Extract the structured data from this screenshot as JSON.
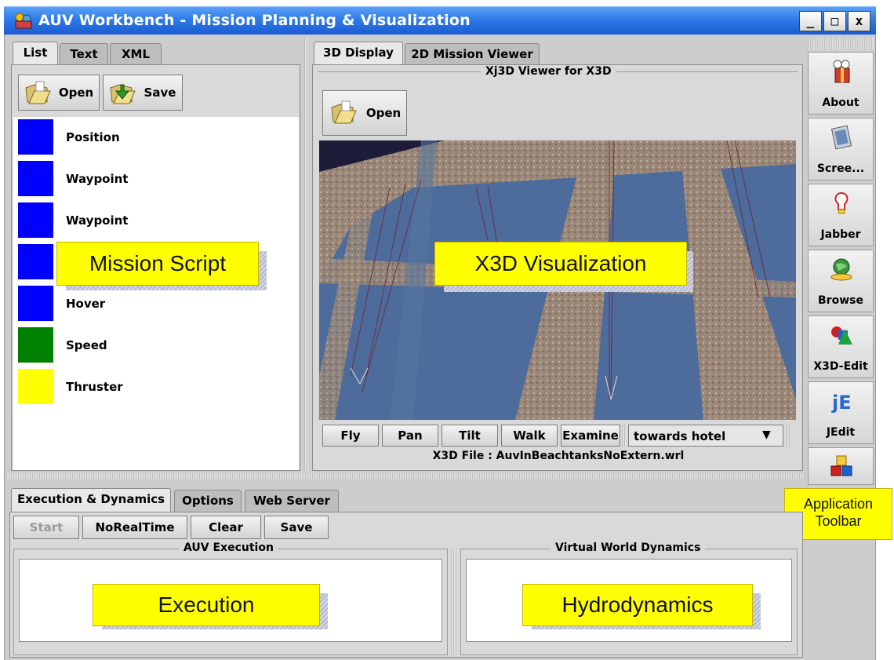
{
  "window": {
    "title": "AUV Workbench - Mission Planning & Visualization",
    "minimize": "_",
    "maximize": "□",
    "close": "x"
  },
  "left_tabs": [
    "List",
    "Text",
    "XML"
  ],
  "left_toolbar": {
    "open": "Open",
    "save": "Save"
  },
  "mission_items": [
    {
      "label": "Position",
      "color": "#0000ff"
    },
    {
      "label": "Waypoint",
      "color": "#0000ff"
    },
    {
      "label": "Waypoint",
      "color": "#0000ff"
    },
    {
      "label": "",
      "color": "#0000ff"
    },
    {
      "label": "Hover",
      "color": "#0000ff"
    },
    {
      "label": "Speed",
      "color": "#008000"
    },
    {
      "label": "Thruster",
      "color": "#ffff00"
    }
  ],
  "callouts": {
    "mission_script": "Mission Script",
    "x3d_visualization": "X3D Visualization",
    "application_toolbar_line1": "Application",
    "application_toolbar_line2": "Toolbar",
    "execution": "Execution",
    "hydrodynamics": "Hydrodynamics"
  },
  "center_tabs": [
    "3D Display",
    "2D Mission Viewer"
  ],
  "viewer": {
    "group_title": "Xj3D Viewer for X3D",
    "open": "Open",
    "nav_buttons": [
      "Fly",
      "Pan",
      "Tilt",
      "Walk",
      "Examine"
    ],
    "viewpoint": "towards hotel",
    "file_label": "X3D File : AuvInBeachtanksNoExtern.wrl"
  },
  "right_toolbar": [
    {
      "label": "About",
      "icon": "about-icon"
    },
    {
      "label": "Scree...",
      "icon": "screen-icon"
    },
    {
      "label": "Jabber",
      "icon": "jabber-icon"
    },
    {
      "label": "Browse",
      "icon": "browse-icon"
    },
    {
      "label": "X3D-Edit",
      "icon": "x3d-edit-icon"
    },
    {
      "label": "JEdit",
      "icon": "jedit-icon"
    },
    {
      "label": "",
      "icon": "cubes-icon"
    }
  ],
  "bottom_tabs": [
    "Execution & Dynamics",
    "Options",
    "Web Server"
  ],
  "bottom_buttons": {
    "start": "Start",
    "norealtime": "NoRealTime",
    "clear": "Clear",
    "save": "Save"
  },
  "bottom_groups": {
    "auv_execution": "AUV Execution",
    "virtual_world": "Virtual World Dynamics"
  },
  "colors": {
    "title_bar": "#2f7ae8",
    "callout": "#ffff00",
    "item_blue": "#0000ff",
    "item_green": "#008000",
    "item_yellow": "#ffff00",
    "water": "#4a6a9a"
  }
}
